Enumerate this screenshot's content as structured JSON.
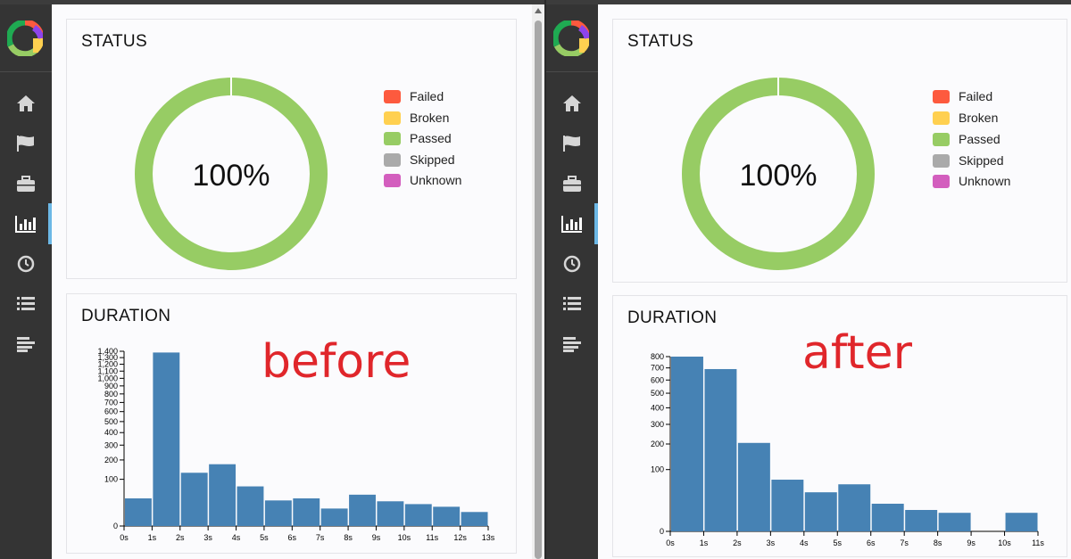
{
  "panels": [
    {
      "status": {
        "title": "STATUS",
        "percent": "100%",
        "passed_fraction": 1.0,
        "legend": [
          {
            "label": "Failed",
            "color": "#fd5a3e"
          },
          {
            "label": "Broken",
            "color": "#ffd050"
          },
          {
            "label": "Passed",
            "color": "#97cc64"
          },
          {
            "label": "Skipped",
            "color": "#aaaaaa"
          },
          {
            "label": "Unknown",
            "color": "#d35ebe"
          }
        ]
      },
      "duration": {
        "title": "DURATION",
        "watermark": "before"
      }
    },
    {
      "status": {
        "title": "STATUS",
        "percent": "100%",
        "passed_fraction": 1.0,
        "legend": [
          {
            "label": "Failed",
            "color": "#fd5a3e"
          },
          {
            "label": "Broken",
            "color": "#ffd050"
          },
          {
            "label": "Passed",
            "color": "#97cc64"
          },
          {
            "label": "Skipped",
            "color": "#aaaaaa"
          },
          {
            "label": "Unknown",
            "color": "#d35ebe"
          }
        ]
      },
      "duration": {
        "title": "DURATION",
        "watermark": "after"
      }
    }
  ],
  "sidebar_icons": [
    "home-icon",
    "flag-icon",
    "briefcase-icon",
    "graph-icon",
    "clock-icon",
    "list-icon",
    "timeline-icon"
  ],
  "chart_data": [
    {
      "type": "pie",
      "title": "STATUS",
      "center_label": "100%",
      "categories": [
        "Failed",
        "Broken",
        "Passed",
        "Skipped",
        "Unknown"
      ],
      "values": [
        0,
        0,
        100,
        0,
        0
      ]
    },
    {
      "type": "bar",
      "title": "DURATION",
      "scale": "sqrt",
      "bar_color": "#4682b4",
      "categories": [
        "0s",
        "1s",
        "2s",
        "3s",
        "4s",
        "5s",
        "6s",
        "7s",
        "8s",
        "9s",
        "10s",
        "11s",
        "12s"
      ],
      "x_ticks": [
        "0s",
        "1s",
        "2s",
        "3s",
        "4s",
        "5s",
        "6s",
        "7s",
        "8s",
        "9s",
        "10s",
        "11s",
        "12s",
        "13s"
      ],
      "values": [
        35,
        1380,
        130,
        175,
        72,
        30,
        35,
        14,
        45,
        28,
        22,
        17,
        9
      ],
      "y_ticks": [
        0,
        100,
        200,
        300,
        400,
        500,
        600,
        700,
        800,
        900,
        1000,
        1100,
        1200,
        1300,
        1400
      ],
      "ylim": [
        0,
        1400
      ]
    },
    {
      "type": "pie",
      "title": "STATUS",
      "center_label": "100%",
      "categories": [
        "Failed",
        "Broken",
        "Passed",
        "Skipped",
        "Unknown"
      ],
      "values": [
        0,
        0,
        100,
        0,
        0
      ]
    },
    {
      "type": "bar",
      "title": "DURATION",
      "scale": "sqrt",
      "bar_color": "#4682b4",
      "categories": [
        "0s",
        "1s",
        "2s",
        "3s",
        "4s",
        "5s",
        "6s",
        "7s",
        "8s",
        "9s",
        "10s"
      ],
      "x_ticks": [
        "0s",
        "1s",
        "2s",
        "3s",
        "4s",
        "5s",
        "6s",
        "7s",
        "8s",
        "9s",
        "10s",
        "11s"
      ],
      "values": [
        800,
        690,
        205,
        70,
        40,
        58,
        20,
        12,
        9,
        0,
        9
      ],
      "y_ticks": [
        0,
        100,
        200,
        300,
        400,
        500,
        600,
        700,
        800
      ],
      "ylim": [
        0,
        800
      ]
    }
  ]
}
